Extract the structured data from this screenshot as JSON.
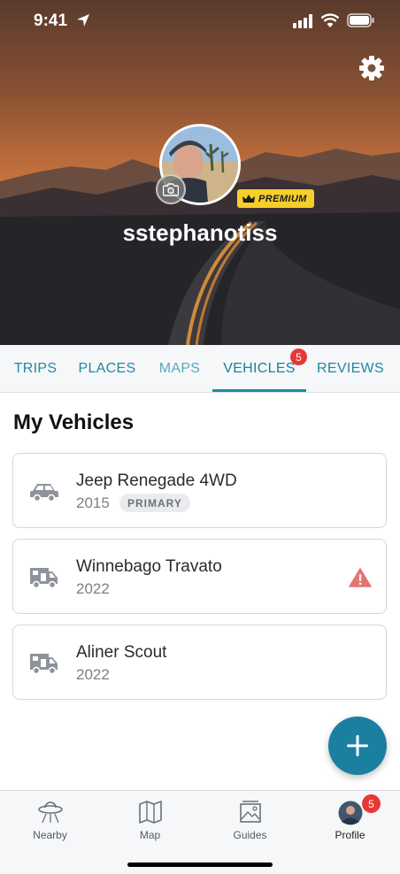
{
  "status_bar": {
    "time": "9:41"
  },
  "profile": {
    "username": "sstephanotiss",
    "premium_label": "PREMIUM"
  },
  "tabs": [
    {
      "label": "TRIPS"
    },
    {
      "label": "PLACES"
    },
    {
      "label": "MAPS"
    },
    {
      "label": "VEHICLES",
      "badge": "5",
      "active": true
    },
    {
      "label": "REVIEWS"
    }
  ],
  "section_title": "My Vehicles",
  "vehicles": [
    {
      "name": "Jeep Renegade 4WD",
      "year": "2015",
      "badge": "PRIMARY",
      "icon": "car-icon"
    },
    {
      "name": "Winnebago Travato",
      "year": "2022",
      "warning": true,
      "icon": "rv-icon"
    },
    {
      "name": "Aliner Scout",
      "year": "2022",
      "icon": "rv-icon"
    }
  ],
  "fab": {
    "icon": "plus-icon"
  },
  "bottom_nav": [
    {
      "label": "Nearby",
      "icon": "ufo-icon"
    },
    {
      "label": "Map",
      "icon": "map-icon"
    },
    {
      "label": "Guides",
      "icon": "guides-icon"
    },
    {
      "label": "Profile",
      "icon": "profile-icon",
      "badge": "5",
      "active": true
    }
  ],
  "colors": {
    "accent": "#1f8aa3",
    "fab": "#1b7fa0",
    "badge": "#e53935",
    "premium": "#f5cf2b",
    "warning": "#e57373"
  }
}
